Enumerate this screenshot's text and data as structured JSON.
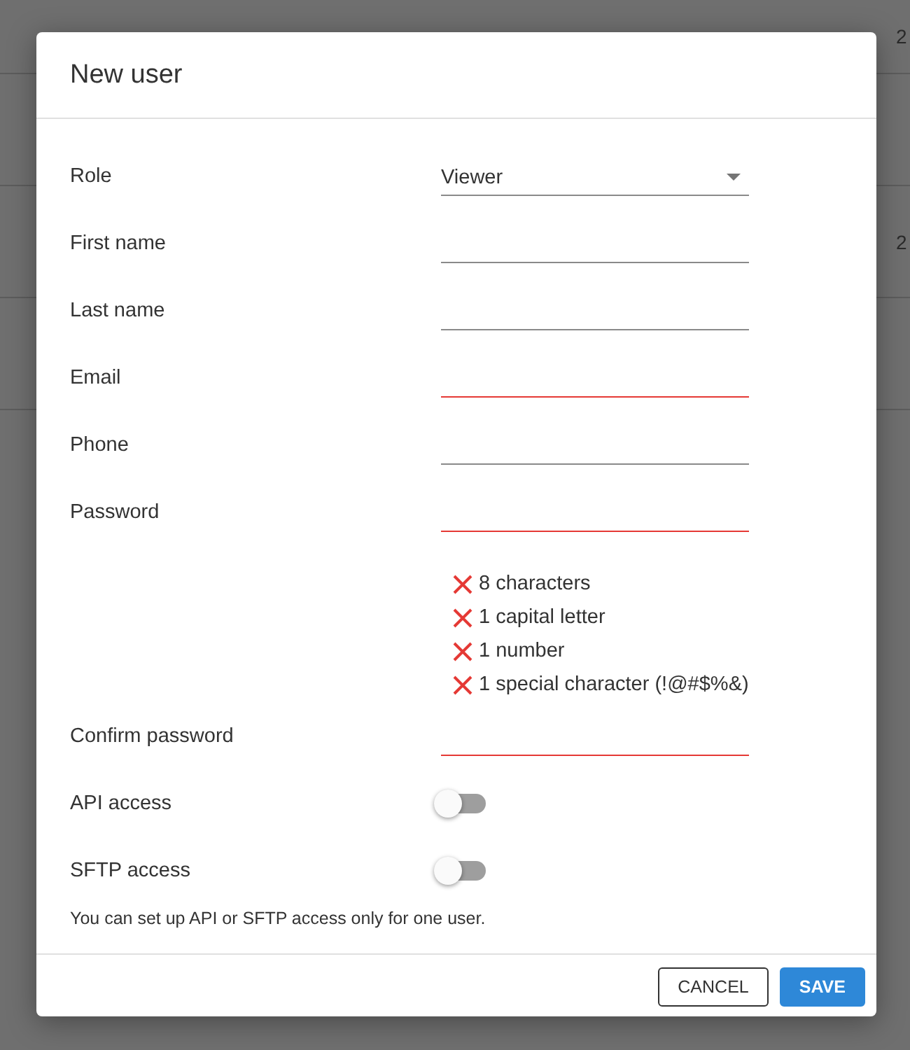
{
  "background_table": {
    "rows": [
      {
        "column_last": "2"
      },
      {
        "column_last": "2"
      }
    ]
  },
  "dialog": {
    "title": "New user",
    "fields": [
      {
        "kind": "select",
        "label": "Role",
        "value": "Viewer",
        "error": false
      },
      {
        "kind": "text",
        "label": "First name",
        "error": false
      },
      {
        "kind": "text",
        "label": "Last name",
        "error": false
      },
      {
        "kind": "text",
        "label": "Email",
        "error": true
      },
      {
        "kind": "text",
        "label": "Phone",
        "error": false
      },
      {
        "kind": "text",
        "label": "Password",
        "error": true
      },
      {
        "kind": "rules",
        "rules": [
          {
            "text": "8 characters",
            "met": false
          },
          {
            "text": "1 capital letter",
            "met": false
          },
          {
            "text": "1 number",
            "met": false
          },
          {
            "text": "1 special character (!@#$%&)",
            "met": false
          }
        ]
      },
      {
        "kind": "text",
        "label": "Confirm password",
        "error": true
      },
      {
        "kind": "toggle",
        "label": "API access",
        "on": false
      },
      {
        "kind": "toggle",
        "label": "SFTP access",
        "on": false
      }
    ],
    "note": "You can set up API or SFTP access only for one user.",
    "buttons": [
      {
        "kind": "outlined",
        "label": "CANCEL"
      },
      {
        "kind": "primary",
        "label": "SAVE"
      }
    ]
  }
}
